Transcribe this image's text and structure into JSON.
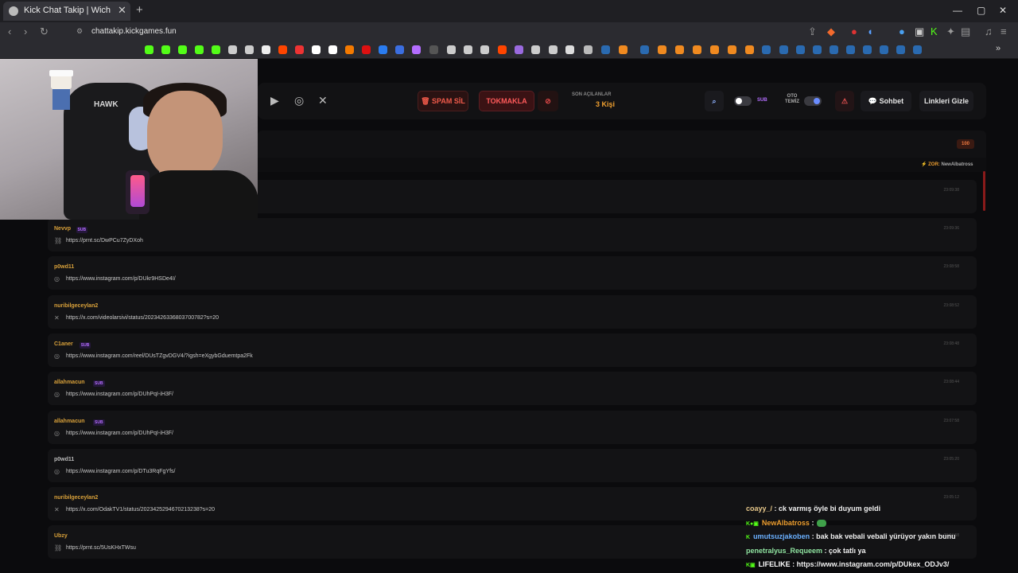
{
  "browser": {
    "tab_title": "Kick Chat Takip | Wich",
    "tab_close": "✕",
    "new_tab": "+",
    "url": "chattakip.kickgames.fun",
    "window_controls": [
      "—",
      "▢",
      "✕"
    ]
  },
  "webcam": {
    "chair_brand": "HAWK"
  },
  "header": {
    "social_icons": [
      "youtube-icon",
      "instagram-icon",
      "x-icon"
    ],
    "spam_button": "🗑 SPAM SİL",
    "tokmakla_button": "TOKMAKLA",
    "ban_icon": "⊘",
    "son_acilanlar_label": "SON AÇILANLAR",
    "son_acilanlar_value": "3 Kişi",
    "search_icon": "⌕",
    "sub_toggle_label": "SUB",
    "oto_temiz_label": "OTO\nTEMİZ",
    "alert_icon": "⚠",
    "sohbet_button": "💬 Sohbet",
    "linkleri_gizle_button": "Linkleri Gizle"
  },
  "feed": {
    "count_badge": "100",
    "status_prefix": "⚡ ZOR:",
    "status_user": "NewAlbatross",
    "sub_badge": "SUB",
    "cards": [
      {
        "user": "Nevvp",
        "sub": true,
        "icon": "link",
        "link": "https://prnt.sc/DwPCu7ZyDXoh",
        "time": "23:09:36"
      },
      {
        "user": "p0wd11",
        "sub": false,
        "icon": "instagram",
        "link": "https://www.instagram.com/p/DUkr9HSDe4I/",
        "time": "23:08:58"
      },
      {
        "user": "nuribilgeceylan2",
        "sub": false,
        "icon": "x",
        "link": "https://x.com/videolarsivi/status/2023426336803700782?s=20",
        "time": "23:08:52"
      },
      {
        "user": "C1aner",
        "sub": true,
        "icon": "instagram",
        "link": "https://www.instagram.com/reel/DUsTZgvDGV4/?igsh=eXgybGduemtpa2Fk",
        "time": "23:08:48"
      },
      {
        "user": "allahmacun",
        "sub": true,
        "icon": "instagram",
        "link": "https://www.instagram.com/p/DUhPqI-iH3F/",
        "time": "23:08:44"
      },
      {
        "user": "allahmacun",
        "sub": true,
        "icon": "instagram",
        "link": "https://www.instagram.com/p/DUhPqI-iH3F/",
        "time": "23:07:58"
      },
      {
        "user": "p0wd11",
        "sub": false,
        "icon": "instagram",
        "link": "https://www.instagram.com/p/DTu3RqFgYfs/",
        "time": "23:05:20",
        "gray": true
      },
      {
        "user": "nuribilgeceylan2",
        "sub": false,
        "icon": "x",
        "link": "https://x.com/OdakTV1/status/2023425294670213238?s=20",
        "time": "23:05:12"
      },
      {
        "user": "Ubzy",
        "sub": false,
        "icon": "link",
        "link": "https://prnt.sc/5UsKHxTWsu",
        "time": "23:04:58"
      }
    ]
  },
  "chat": [
    {
      "name": "coayy_/",
      "msg": ": ck varmış öyle bi duyum geldi",
      "color": "#e6c78a",
      "badges": ""
    },
    {
      "name": "NewAlbatross",
      "msg": ":",
      "color": "#f0a030",
      "badges": "K●▣"
    },
    {
      "name": "umutsuzjakoben",
      "msg": ": bak bak vebali vebali yürüyor yakın bunu",
      "color": "#6ab0ff",
      "badges": "K"
    },
    {
      "name": "penetralyus_Requeem",
      "msg": ": çok tatlı ya",
      "color": "#8fe3a0",
      "badges": ""
    },
    {
      "name": "LIFELIKE",
      "msg": ": https://www.instagram.com/p/DUkex_ODJv3/",
      "color": "#ffffff",
      "badges": "K▣"
    }
  ],
  "colors": {
    "accent": "#f0a030",
    "danger": "#ff5a5a",
    "sub": "#b46dff"
  }
}
